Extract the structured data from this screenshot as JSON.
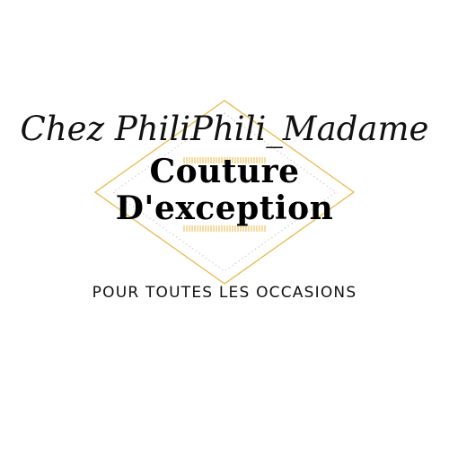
{
  "logo": {
    "script_name": "Chez PhiliPhili_Madame",
    "title_line_1": "Couture",
    "title_line_2": "D'exception",
    "tagline": "POUR TOUTES LES OCCASIONS"
  },
  "colors": {
    "accent_gold": "#e8b94a",
    "dot_gray": "#c8c8c8",
    "text": "#000000",
    "background": "#ffffff"
  }
}
